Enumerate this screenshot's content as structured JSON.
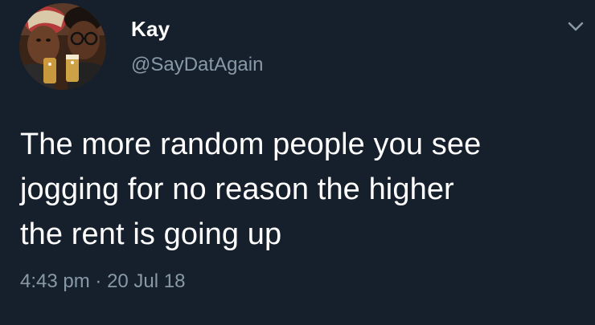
{
  "tweet": {
    "display_name": "Kay",
    "handle": "@SayDatAgain",
    "text_lines": [
      "The more random people you see",
      "jogging for no reason the higher",
      "the rent is going up"
    ],
    "time": "4:43 pm",
    "separator": "·",
    "date": "20 Jul 18"
  },
  "icons": {
    "menu": "chevron-down-icon"
  },
  "colors": {
    "background": "#16202c",
    "text": "#ffffff",
    "secondary": "#8899a6"
  }
}
